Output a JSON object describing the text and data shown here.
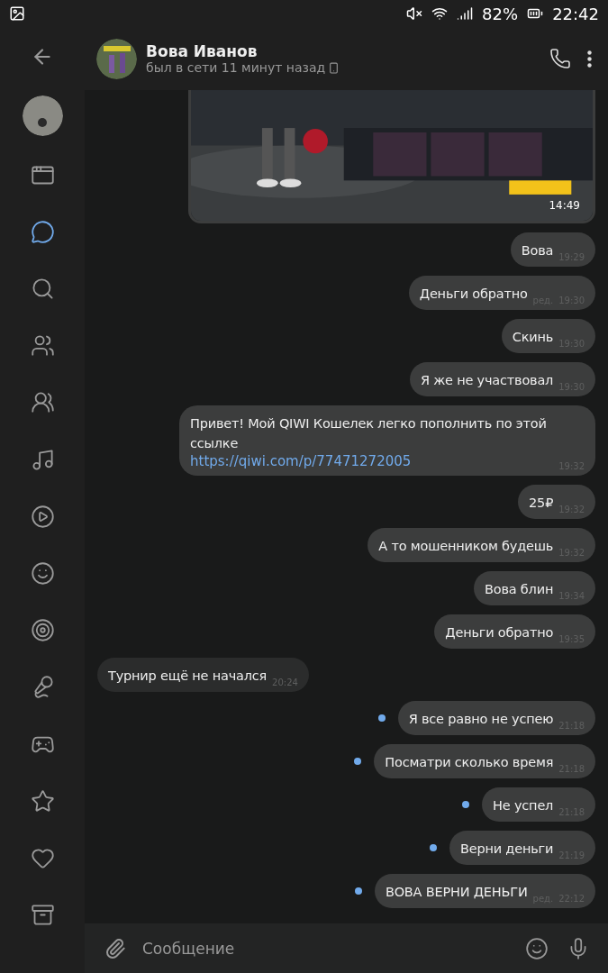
{
  "status_bar": {
    "battery": "82%",
    "time": "22:42"
  },
  "sidebar": {
    "items": [
      {
        "kind": "newsfeed",
        "selected": false
      },
      {
        "kind": "messages",
        "selected": true
      },
      {
        "kind": "search",
        "selected": false
      },
      {
        "kind": "friends",
        "selected": false
      },
      {
        "kind": "communities",
        "selected": false
      },
      {
        "kind": "music",
        "selected": false
      },
      {
        "kind": "video",
        "selected": false
      },
      {
        "kind": "stickers",
        "selected": false
      },
      {
        "kind": "services",
        "selected": false
      },
      {
        "kind": "podcasts",
        "selected": false
      },
      {
        "kind": "games",
        "selected": false
      },
      {
        "kind": "bookmarks",
        "selected": false
      },
      {
        "kind": "likes",
        "selected": false
      },
      {
        "kind": "archive",
        "selected": false
      }
    ]
  },
  "header": {
    "name": "Вова Иванов",
    "status": "был в сети 11 минут назад"
  },
  "messages": [
    {
      "outgoing": true,
      "time": "14:49"
    },
    {
      "kind": "text",
      "outgoing": true,
      "text": "Вова",
      "time": "19:29",
      "unread": false
    },
    {
      "kind": "text",
      "outgoing": true,
      "text": "Деньги обратно",
      "edited": "ред.",
      "time": "19:30",
      "unread": false
    },
    {
      "kind": "text",
      "outgoing": true,
      "text": "Скинь",
      "time": "19:30",
      "unread": false
    },
    {
      "kind": "text",
      "outgoing": true,
      "text": "Я же не участвовал",
      "time": "19:30",
      "unread": false
    },
    {
      "kind": "text",
      "outgoing": true,
      "text": "Привет! Мой QIWI Кошелек легко пополнить по этой ссылке",
      "link": "https://qiwi.com/p/77471272005",
      "time": "19:32",
      "unread": false
    },
    {
      "kind": "text",
      "outgoing": true,
      "text": "25₽",
      "time": "19:32",
      "unread": false
    },
    {
      "kind": "text",
      "outgoing": true,
      "text": "А то мошенником будешь",
      "time": "19:32",
      "unread": false
    },
    {
      "kind": "text",
      "outgoing": true,
      "text": "Вова блин",
      "time": "19:34",
      "unread": false
    },
    {
      "kind": "text",
      "outgoing": true,
      "text": "Деньги обратно",
      "time": "19:35",
      "unread": false
    },
    {
      "kind": "text",
      "outgoing": false,
      "text": "Турнир ещё не начался",
      "time": "20:24",
      "unread": false
    },
    {
      "kind": "text",
      "outgoing": true,
      "text": "Я все равно не успею",
      "time": "21:18",
      "unread": true
    },
    {
      "kind": "text",
      "outgoing": true,
      "text": "Посматри сколько время",
      "time": "21:18",
      "unread": true
    },
    {
      "kind": "text",
      "outgoing": true,
      "text": "Не успел",
      "time": "21:18",
      "unread": true
    },
    {
      "kind": "text",
      "outgoing": true,
      "text": "Верни деньги",
      "time": "21:19",
      "unread": true
    },
    {
      "kind": "text",
      "outgoing": true,
      "text": "ВОВА ВЕРНИ ДЕНЬГИ",
      "edited": "ред.",
      "time": "22:12",
      "unread": true
    }
  ],
  "composer": {
    "placeholder": "Сообщение"
  }
}
